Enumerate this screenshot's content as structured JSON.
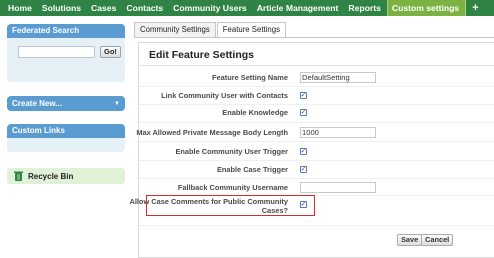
{
  "topnav": {
    "tabs": [
      {
        "label": "Home"
      },
      {
        "label": "Solutions"
      },
      {
        "label": "Cases"
      },
      {
        "label": "Contacts"
      },
      {
        "label": "Community Users"
      },
      {
        "label": "Article Management"
      },
      {
        "label": "Reports"
      },
      {
        "label": "Custom settings"
      }
    ],
    "plus": "+",
    "active_color": "#7bb241",
    "bar_color": "#2f8445"
  },
  "sidebar": {
    "federated_search": {
      "title": "Federated Search",
      "input_value": "",
      "go_label": "Go!"
    },
    "create_new": {
      "label": "Create New...",
      "caret": "▼"
    },
    "custom_links": {
      "title": "Custom Links"
    },
    "recycle_bin": {
      "label": "Recycle Bin",
      "icon": "recycle-bin-icon"
    }
  },
  "subtabs": [
    {
      "label": "Community Settings"
    },
    {
      "label": "Feature Settings"
    }
  ],
  "panel": {
    "title": "Edit Feature Settings",
    "fields": [
      {
        "label": "Feature Setting Name",
        "type": "text",
        "value": "DefaultSetting"
      },
      {
        "label": "Link Community User with Contacts",
        "type": "checkbox",
        "checked": true
      },
      {
        "label": "Enable Knowledge",
        "type": "checkbox",
        "checked": true
      },
      {
        "label": "Max Allowed Private Message Body Length",
        "type": "text",
        "value": "1000"
      },
      {
        "label": "Enable Community User Trigger",
        "type": "checkbox",
        "checked": true
      },
      {
        "label": "Enable Case Trigger",
        "type": "checkbox",
        "checked": true
      },
      {
        "label": "Fallback Community Username",
        "type": "text",
        "value": ""
      },
      {
        "label_line1": "Allow Case Comments for Public Community",
        "label_line2": "Cases?",
        "type": "checkbox",
        "checked": true
      }
    ],
    "checkmark": "✓",
    "save_label": "Save",
    "cancel_label": "Cancel",
    "highlight_color": "#d42d2d"
  }
}
